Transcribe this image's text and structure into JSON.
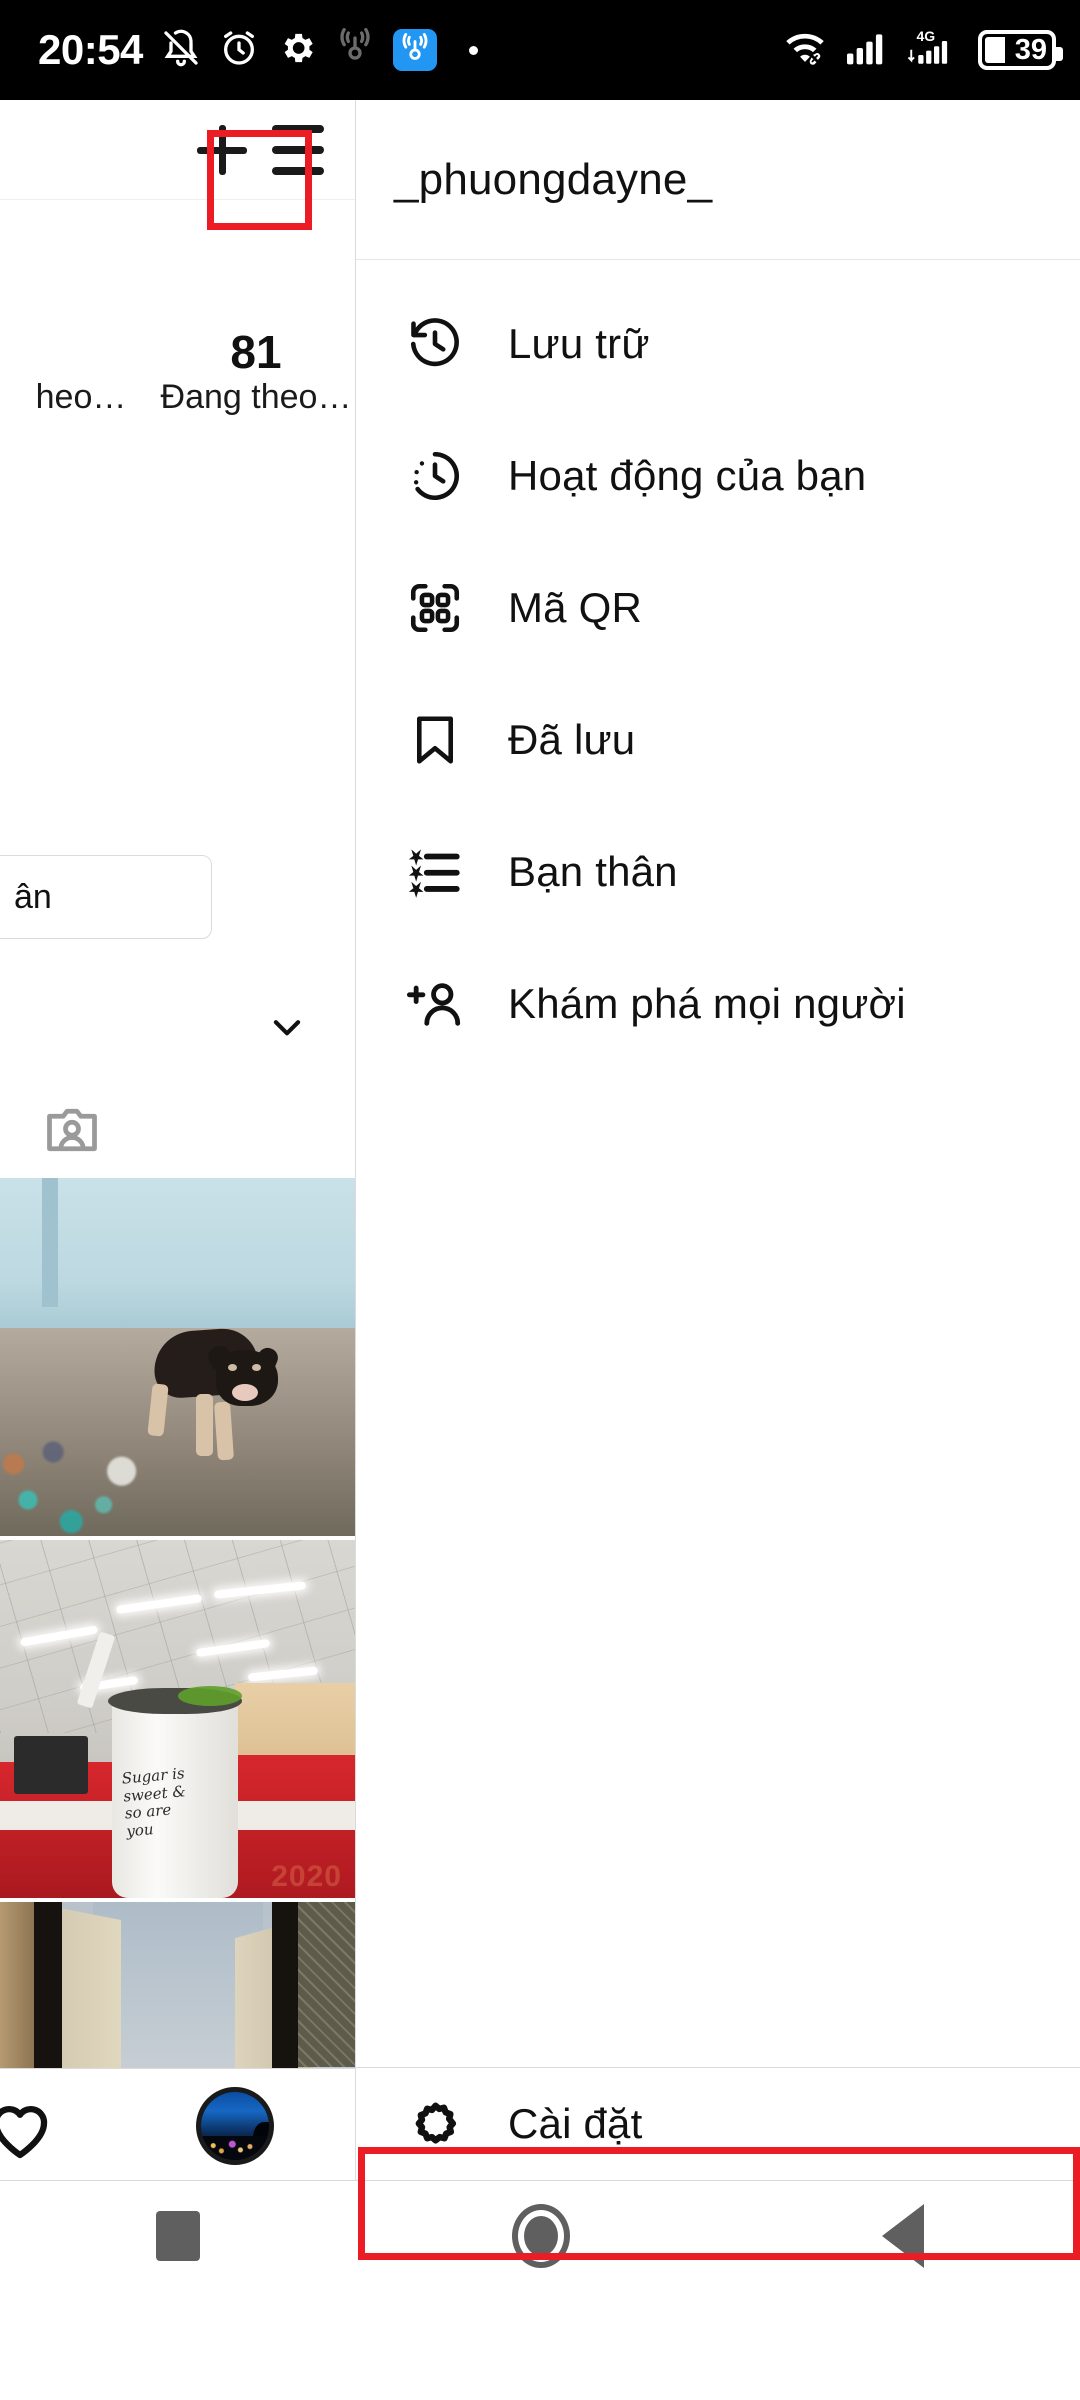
{
  "status_bar": {
    "time": "20:54",
    "battery_level": "39",
    "network_type": "4G",
    "icons": [
      "notifications-muted-icon",
      "alarm-icon",
      "gear-icon",
      "hotspot-icon",
      "hotspot-active-icon",
      "dot-icon",
      "wifi-icon",
      "signal-icon",
      "signal-4g-icon",
      "battery-icon"
    ]
  },
  "profile_panel": {
    "add_label": "+",
    "stats": [
      {
        "value": "",
        "label": "heo…"
      },
      {
        "value": "81",
        "label": "Đang theo…"
      }
    ],
    "edit_profile_label": "ân",
    "grid_photos": [
      {
        "alt": "dog-by-blue-wall"
      },
      {
        "alt": "drink-cup-in-office"
      },
      {
        "alt": "alley-between-buildings"
      }
    ],
    "cup_text_line1": "Sugar is",
    "cup_text_line2": "sweet &",
    "cup_text_line3": "so are",
    "cup_text_line4": "you",
    "cup_year": "2020",
    "bottom_nav": [
      "heart-icon",
      "profile-avatar"
    ]
  },
  "drawer": {
    "username": "_phuongdayne_",
    "items": [
      {
        "icon": "archive-clock-icon",
        "label": "Lưu trữ"
      },
      {
        "icon": "activity-clock-icon",
        "label": "Hoạt động của bạn"
      },
      {
        "icon": "qr-code-icon",
        "label": "Mã QR"
      },
      {
        "icon": "bookmark-icon",
        "label": "Đã lưu"
      },
      {
        "icon": "close-friends-star-list-icon",
        "label": "Bạn thân"
      },
      {
        "icon": "person-add-icon",
        "label": "Khám phá mọi người"
      }
    ],
    "settings": {
      "icon": "gear-icon",
      "label": "Cài đặt"
    }
  },
  "annotations": {
    "highlight_color": "#ec1c24",
    "boxes": [
      "hamburger-menu-button",
      "settings-menu-item"
    ]
  },
  "android_nav": {
    "recents_label": "recents-square-icon",
    "home_label": "home-circle-icon",
    "back_label": "back-triangle-icon"
  }
}
